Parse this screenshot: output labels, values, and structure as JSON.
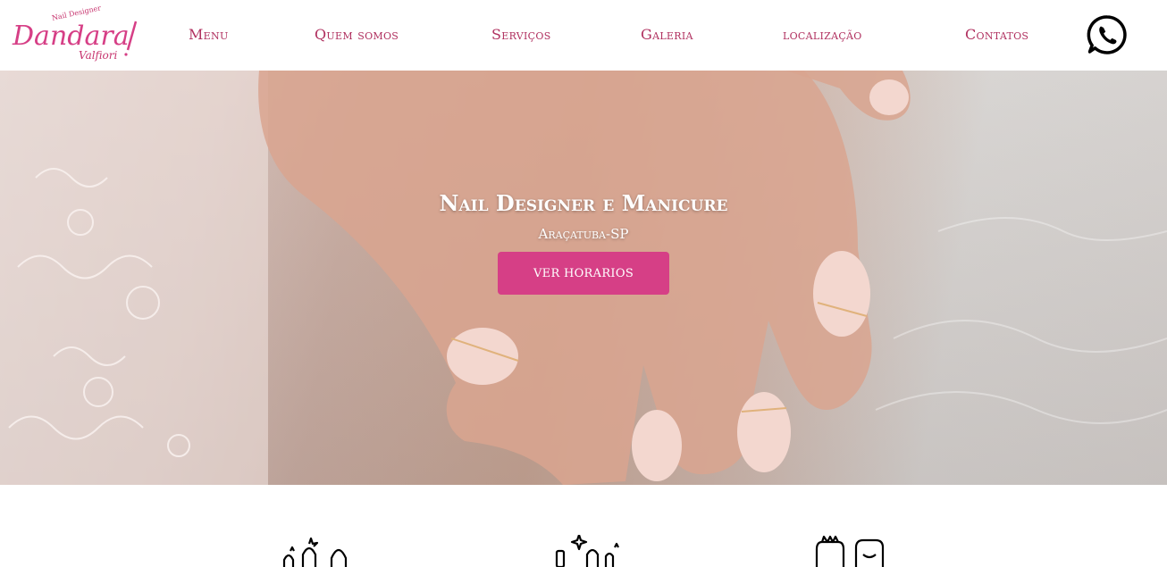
{
  "brand": {
    "logo_script": "Dandara",
    "logo_surname": "Valfiori",
    "logo_tagline": "Nail Designer",
    "logo_color": "#d63f86"
  },
  "nav": {
    "items": [
      {
        "label": "Menu"
      },
      {
        "label": "Quem somos"
      },
      {
        "label": "Serviços"
      },
      {
        "label": "Galeria"
      },
      {
        "label": "localização"
      },
      {
        "label": "Contatos"
      }
    ],
    "link_color": "#b0305f",
    "whatsapp_icon": "whatsapp-icon"
  },
  "hero": {
    "title": "Nail Designer e Manicure",
    "subtitle": "Araçatuba-SP",
    "button_label": "VER HORARIOS",
    "button_color": "#d63f86"
  },
  "services": {
    "icons": [
      "nail-polish-icon",
      "manicure-tools-icon",
      "hands-care-icon"
    ]
  }
}
